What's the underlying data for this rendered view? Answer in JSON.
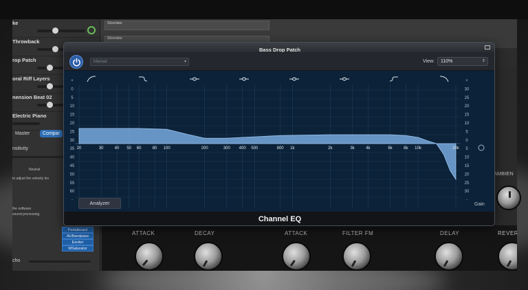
{
  "colors": {
    "accent_blue": "#2f6fb6",
    "eq_fill": "#6f9ed0",
    "graph_bg": "#0b2238",
    "grid_line": "#1d3a58",
    "power_green": "#6bbf59"
  },
  "left_panel": {
    "tracks": [
      {
        "label": "ke",
        "knob_level": 0.35,
        "power": true
      },
      {
        "label": "Throwback",
        "knob_level": 0.35,
        "power": false
      },
      {
        "label": "rop Patch",
        "knob_level": 0.3,
        "power": false
      },
      {
        "label": "oral Riff Layers",
        "knob_level": 0.3,
        "power": false
      },
      {
        "label": "nension Beat 02",
        "knob_level": 0.3,
        "power": false
      },
      {
        "label": "Electric Piano",
        "knob_level": 0.0,
        "power": false
      }
    ],
    "tabs": [
      {
        "label": "Master",
        "active": false
      },
      {
        "label": "Compar",
        "active": true
      }
    ],
    "sensitivity_label": "nsitivity",
    "neutral_label": "Neutral",
    "velocity_text": "to adjust the velocity lev",
    "software_text_1": "the software",
    "software_text_2": "sound processing.",
    "plugins": [
      "Pedalboard",
      "AUBandpass",
      "Exciter",
      "MSaturator"
    ],
    "echo_label": "cho"
  },
  "tracks_area": {
    "regions": [
      "Silverlake",
      "Silverlake"
    ]
  },
  "synth": {
    "knobs": [
      {
        "label": "ATTACK"
      },
      {
        "label": "DECAY"
      },
      {
        "label": "ATTACK"
      },
      {
        "label": "FILTER FM"
      },
      {
        "label": "DELAY"
      },
      {
        "label": "REVER"
      }
    ],
    "ambience_label": "AMBIEN"
  },
  "eq_window": {
    "title": "Bass Drop Patch",
    "preset_value": "Manual",
    "view_label": "View:",
    "view_value": "110%",
    "plugin_name": "Channel EQ",
    "analyzer_label": "Analyzer",
    "gain_label": "Gain",
    "band_icons": [
      "low-cut-icon",
      "low-shelf-icon",
      "peak-band-icon",
      "peak-band-icon",
      "peak-band-icon",
      "peak-band-icon",
      "high-shelf-icon",
      "high-cut-icon"
    ],
    "freq_labels": [
      "20",
      "30",
      "40",
      "50",
      "60",
      "80",
      "100",
      "200",
      "300",
      "400",
      "500",
      "800",
      "1k",
      "2k",
      "3k",
      "4k",
      "6k",
      "8k",
      "10k",
      "20k"
    ],
    "left_db_labels": [
      "+",
      "0",
      "5",
      "10",
      "15",
      "20",
      "25",
      "30",
      "35",
      "40",
      "45",
      "50",
      "55",
      "60",
      "-"
    ],
    "right_db_labels": [
      "+",
      "30",
      "25",
      "20",
      "15",
      "10",
      "5",
      "0",
      "5",
      "10",
      "15",
      "20",
      "25",
      "30",
      "-"
    ]
  },
  "chart_data": {
    "type": "area",
    "title": "",
    "xlabel": "",
    "ylabel": "Gain",
    "x_scale": "log",
    "xlim": [
      20,
      20000
    ],
    "ylim": [
      -30,
      30
    ],
    "grid": true,
    "series": [
      {
        "x": [
          20,
          60,
          100,
          150,
          200,
          300,
          400,
          800,
          2000,
          6000,
          8000,
          10000,
          12000,
          14000,
          16000,
          18000,
          20000
        ],
        "y": [
          8.5,
          8.5,
          8,
          5,
          3,
          3,
          3.5,
          4.5,
          5,
          5,
          4.5,
          3.5,
          1.5,
          0,
          -6,
          -15,
          -20
        ]
      }
    ]
  }
}
